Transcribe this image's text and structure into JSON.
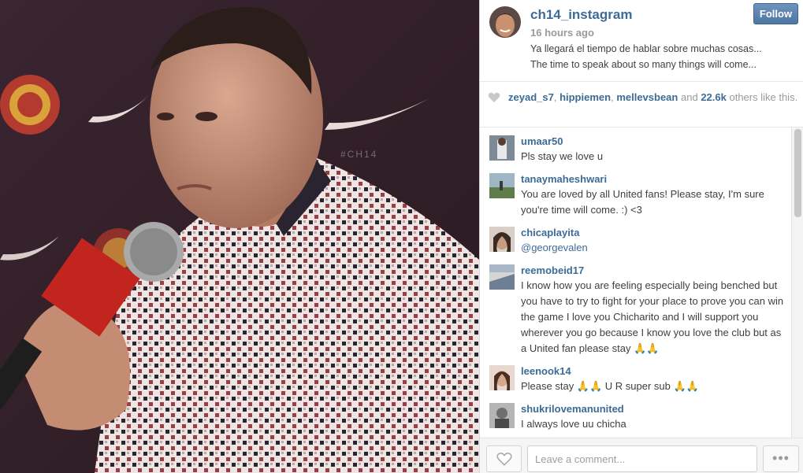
{
  "post": {
    "username": "ch14_instagram",
    "time": "16 hours ago",
    "caption_lines": [
      "Ya llegará el tiempo de hablar sobre muchas cosas...",
      "The time to speak about so many things will come..."
    ],
    "follow_label": "Follow",
    "photo_watermark": "#CH14"
  },
  "likes": {
    "users": [
      "zeyad_s7",
      "hippiemen",
      "mellevsbean"
    ],
    "and_text": "and",
    "count": "22.6k",
    "others_text": "others like this."
  },
  "comments": [
    {
      "user": "umaar50",
      "text": "Pls stay we love u"
    },
    {
      "user": "tanaymaheshwari",
      "text": "You are loved by all United fans! Please stay, I'm sure you're time will come. :) <3"
    },
    {
      "user": "chicaplayita",
      "text": "@georgevalen"
    },
    {
      "user": "reemobeid17",
      "text": "I know how you are feeling especially being benched but you have to try to fight for your place to prove you can win the game I love you Chicharito and I will support you wherever you go because I know you love the club but as a United fan please stay 🙏🙏"
    },
    {
      "user": "leenook14",
      "text": "Please stay 🙏🙏 U R super sub 🙏🙏"
    },
    {
      "user": "shukrilovemanunited",
      "text": "I always love uu chicha"
    }
  ],
  "footer": {
    "comment_placeholder": "Leave a comment...",
    "more_label": "•••"
  },
  "colors": {
    "username": "#3d6b98",
    "follow_button": "#5a80ad",
    "muted_text": "#9a9a9a"
  },
  "icons": {
    "like": "heart-icon",
    "more": "ellipsis-icon"
  }
}
